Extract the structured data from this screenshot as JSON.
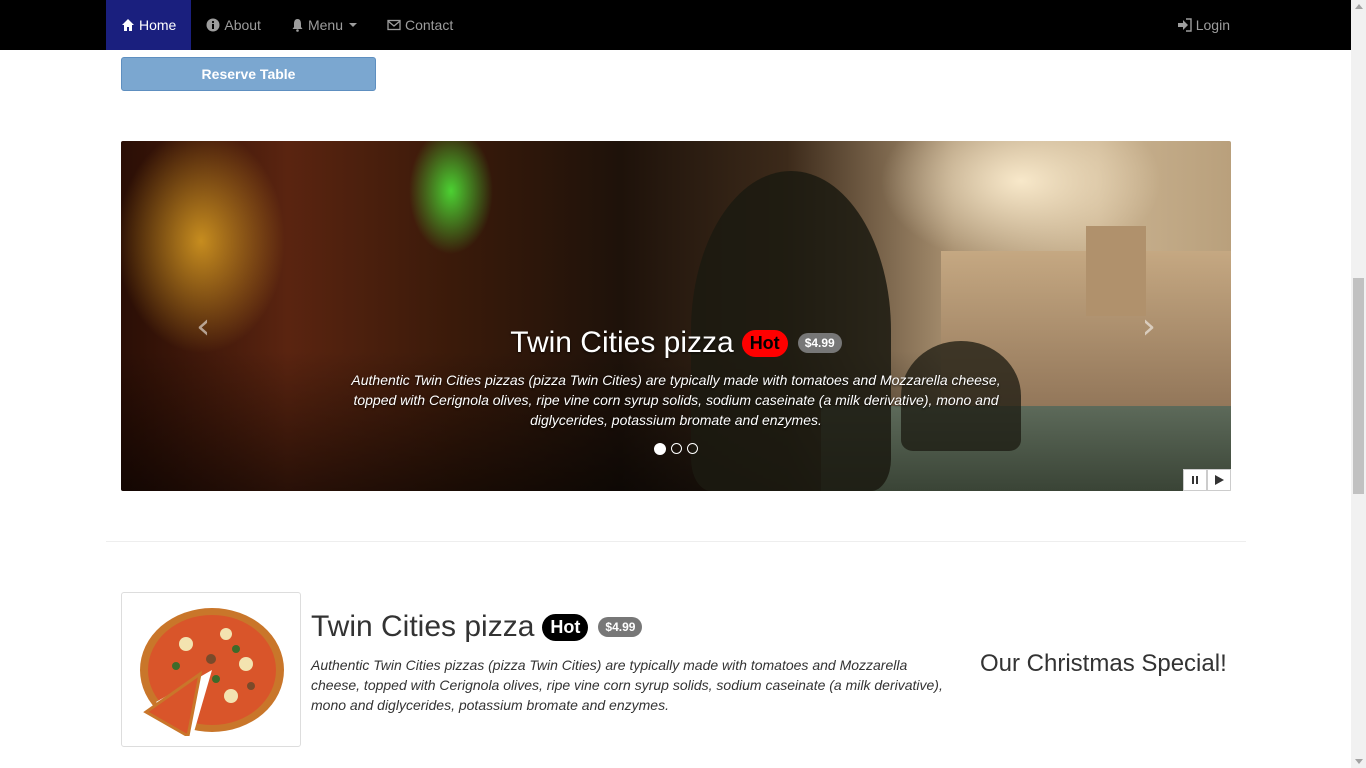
{
  "nav": {
    "items": [
      {
        "label": "Home",
        "icon": "home-icon"
      },
      {
        "label": "About",
        "icon": "info-icon"
      },
      {
        "label": "Menu",
        "icon": "bell-icon"
      },
      {
        "label": "Contact",
        "icon": "envelope-icon"
      }
    ],
    "login": {
      "label": "Login",
      "icon": "login-icon"
    }
  },
  "reserve": {
    "label": "Reserve Table"
  },
  "carousel": {
    "title": "Twin Cities pizza",
    "badge": "Hot",
    "price": "$4.99",
    "description": "Authentic Twin Cities pizzas (pizza Twin Cities) are typically made with tomatoes and Mozzarella cheese, topped with Cerignola olives, ripe vine corn syrup solids, sodium caseinate (a milk derivative), mono and diglycerides, potassium bromate and enzymes.",
    "slide_count": 3,
    "active_slide": 1
  },
  "product": {
    "title": "Twin Cities pizza",
    "badge": "Hot",
    "price": "$4.99",
    "description": "Authentic Twin Cities pizzas (pizza Twin Cities) are typically made with tomatoes and Mozzarella cheese, topped with Cerignola olives, ripe vine corn syrup solids, sodium caseinate (a milk derivative), mono and diglycerides, potassium bromate and enzymes.",
    "special": "Our Christmas Special!"
  },
  "colors": {
    "nav_bg": "#000000",
    "nav_active": "#1a1f7e",
    "reserve_btn": "#7ba7d0",
    "hot_badge_carousel": "#ff0000",
    "hot_badge_product": "#000000",
    "price_badge": "#777777"
  }
}
